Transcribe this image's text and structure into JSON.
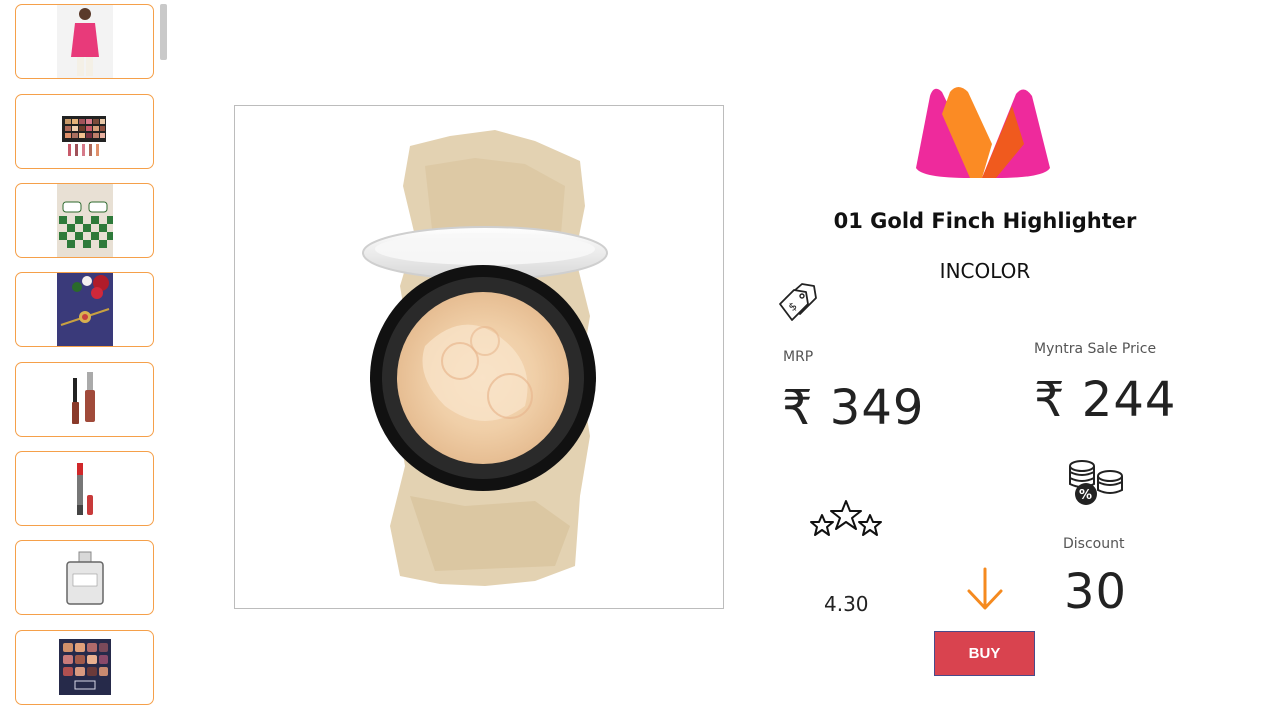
{
  "gallery": {
    "items": [
      {
        "name": "kurta-thumbnail"
      },
      {
        "name": "eyeshadow-palette-thumbnail"
      },
      {
        "name": "bedsheet-thumbnail"
      },
      {
        "name": "rakhi-thumbnail"
      },
      {
        "name": "lip-gloss-thumbnail"
      },
      {
        "name": "lipstick-thumbnail"
      },
      {
        "name": "perfume-thumbnail"
      },
      {
        "name": "palette-thumbnail"
      }
    ]
  },
  "product": {
    "title": "01 Gold Finch Highlighter",
    "brand": "INCOLOR"
  },
  "pricing": {
    "mrp_label": "MRP",
    "mrp_value": "₹ 349",
    "sale_label": "Myntra Sale Price",
    "sale_value": "₹ 244",
    "discount_label": "Discount",
    "discount_value": "30",
    "rating_value": "4.30"
  },
  "actions": {
    "buy_label": "BUY"
  },
  "colors": {
    "accent_orange": "#f5a04a",
    "buy_button": "#d9434f",
    "logo_pink": "#ee2a9c",
    "logo_orange": "#fb8b24"
  },
  "icons": {
    "price_tag": "price-tag-icon",
    "coins": "coins-discount-icon",
    "stars": "stars-icon",
    "down_arrow": "down-arrow-icon"
  }
}
